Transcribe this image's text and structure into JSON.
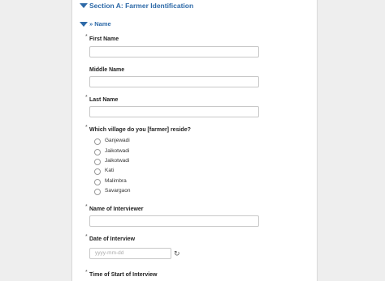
{
  "section": {
    "title": "Section A: Farmer Identification"
  },
  "group": {
    "title": "» Name"
  },
  "required_marker": "*",
  "fields": {
    "first_name": {
      "label": "First Name"
    },
    "middle_name": {
      "label": "Middle Name"
    },
    "last_name": {
      "label": "Last Name"
    },
    "village": {
      "label": "Which village do you [farmer] reside?",
      "options": [
        "Ganjewadi",
        "Jaikotwadi",
        "Jaikotwadi",
        "Kati",
        "Malimbra",
        "Savargaon"
      ]
    },
    "interviewer": {
      "label": "Name of Interviewer"
    },
    "interview_date": {
      "label": "Date of Interview",
      "placeholder": "yyyy-mm-dd"
    },
    "start_time": {
      "label": "Time of Start of Interview"
    }
  },
  "icons": {
    "collapse": "triangle-down-icon",
    "refresh": "refresh-icon"
  },
  "colors": {
    "accent": "#2e6aa8",
    "background": "#eeeeee",
    "panel": "#ffffff"
  }
}
